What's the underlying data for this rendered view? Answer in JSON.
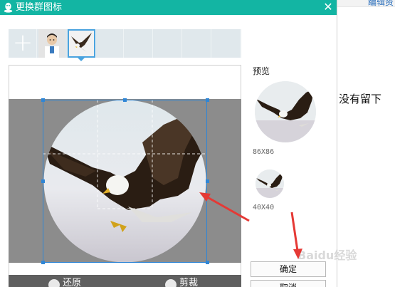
{
  "dialog": {
    "title": "更换群图标",
    "close_glyph": "✕",
    "add_glyph": "+"
  },
  "preview": {
    "label": "预览",
    "size_large": "86X86",
    "size_small": "40X40"
  },
  "crop_toolbar": {
    "restore_label": "还原",
    "crop_label": "剪裁"
  },
  "buttons": {
    "confirm": "确定",
    "cancel": "取消"
  },
  "background_page": {
    "link_text": "编辑资",
    "body_text": "没有留下"
  },
  "watermark": "Baidu经验",
  "colors": {
    "title_bar": "#13b5a3",
    "accent_blue": "#2f86d6",
    "annotation_arrow": "#e53935"
  },
  "icons": {
    "logo": "penguin-logo-icon",
    "close": "close-icon",
    "add": "plus-icon",
    "restore": "undo-icon",
    "crop": "check-icon"
  }
}
